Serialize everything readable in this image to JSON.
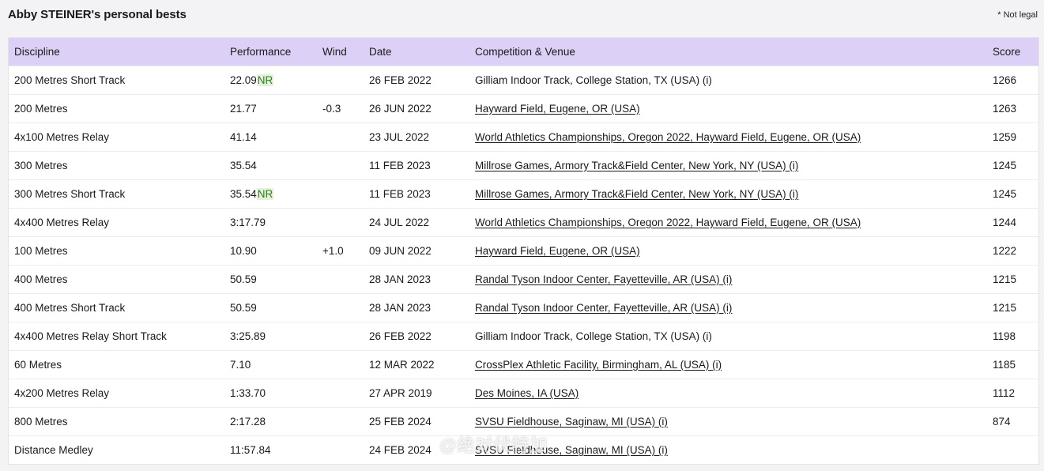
{
  "page": {
    "title": "Abby STEINER's personal bests",
    "legal_note": "* Not legal"
  },
  "table": {
    "headers": {
      "discipline": "Discipline",
      "performance": "Performance",
      "wind": "Wind",
      "date": "Date",
      "venue": "Competition & Venue",
      "score": "Score"
    },
    "rows": [
      {
        "discipline": "200 Metres Short Track",
        "performance": "22.09",
        "mark": "NR",
        "wind": "",
        "date": "26 FEB 2022",
        "venue": "Gilliam Indoor Track, College Station, TX (USA) (i)",
        "linked": false,
        "score": "1266"
      },
      {
        "discipline": "200 Metres",
        "performance": "21.77",
        "mark": "",
        "wind": "-0.3",
        "date": "26 JUN 2022",
        "venue": "Hayward Field, Eugene, OR (USA)",
        "linked": true,
        "score": "1263"
      },
      {
        "discipline": "4x100 Metres Relay",
        "performance": "41.14",
        "mark": "",
        "wind": "",
        "date": "23 JUL 2022",
        "venue": "World Athletics Championships, Oregon 2022, Hayward Field, Eugene, OR (USA)",
        "linked": true,
        "score": "1259"
      },
      {
        "discipline": "300 Metres",
        "performance": "35.54",
        "mark": "",
        "wind": "",
        "date": "11 FEB 2023",
        "venue": "Millrose Games, Armory Track&Field Center, New York, NY (USA) (i)",
        "linked": true,
        "score": "1245"
      },
      {
        "discipline": "300 Metres Short Track",
        "performance": "35.54",
        "mark": "NR",
        "wind": "",
        "date": "11 FEB 2023",
        "venue": "Millrose Games, Armory Track&Field Center, New York, NY (USA) (i)",
        "linked": true,
        "score": "1245"
      },
      {
        "discipline": "4x400 Metres Relay",
        "performance": "3:17.79",
        "mark": "",
        "wind": "",
        "date": "24 JUL 2022",
        "venue": "World Athletics Championships, Oregon 2022, Hayward Field, Eugene, OR (USA)",
        "linked": true,
        "score": "1244"
      },
      {
        "discipline": "100 Metres",
        "performance": "10.90",
        "mark": "",
        "wind": "+1.0",
        "date": "09 JUN 2022",
        "venue": "Hayward Field, Eugene, OR (USA)",
        "linked": true,
        "score": "1222"
      },
      {
        "discipline": "400 Metres",
        "performance": "50.59",
        "mark": "",
        "wind": "",
        "date": "28 JAN 2023",
        "venue": "Randal Tyson Indoor Center, Fayetteville, AR (USA) (i)",
        "linked": true,
        "score": "1215"
      },
      {
        "discipline": "400 Metres Short Track",
        "performance": "50.59",
        "mark": "",
        "wind": "",
        "date": "28 JAN 2023",
        "venue": "Randal Tyson Indoor Center, Fayetteville, AR (USA) (i)",
        "linked": true,
        "score": "1215"
      },
      {
        "discipline": "4x400 Metres Relay Short Track",
        "performance": "3:25.89",
        "mark": "",
        "wind": "",
        "date": "26 FEB 2022",
        "venue": "Gilliam Indoor Track, College Station, TX (USA) (i)",
        "linked": false,
        "score": "1198"
      },
      {
        "discipline": "60 Metres",
        "performance": "7.10",
        "mark": "",
        "wind": "",
        "date": "12 MAR 2022",
        "venue": "CrossPlex Athletic Facility, Birmingham, AL (USA) (i)",
        "linked": true,
        "score": "1185"
      },
      {
        "discipline": "4x200 Metres Relay",
        "performance": "1:33.70",
        "mark": "",
        "wind": "",
        "date": "27 APR 2019",
        "venue": "Des Moines, IA (USA)",
        "linked": true,
        "score": "1112"
      },
      {
        "discipline": "800 Metres",
        "performance": "2:17.28",
        "mark": "",
        "wind": "",
        "date": "25 FEB 2024",
        "venue": "SVSU Fieldhouse, Saginaw, MI (USA) (i)",
        "linked": true,
        "score": "874"
      },
      {
        "discipline": "Distance Medley",
        "performance": "11:57.84",
        "mark": "",
        "wind": "",
        "date": "24 FEB 2024",
        "venue": "SVSU Fieldhouse, Saginaw, MI (USA) (i)",
        "linked": true,
        "score": ""
      }
    ]
  },
  "watermark": {
    "text": "@绝对伏特加"
  },
  "colors": {
    "header_bg": "#ddd0f7",
    "nr_bg": "#e3f3d8",
    "nr_text": "#2f7d1f"
  }
}
